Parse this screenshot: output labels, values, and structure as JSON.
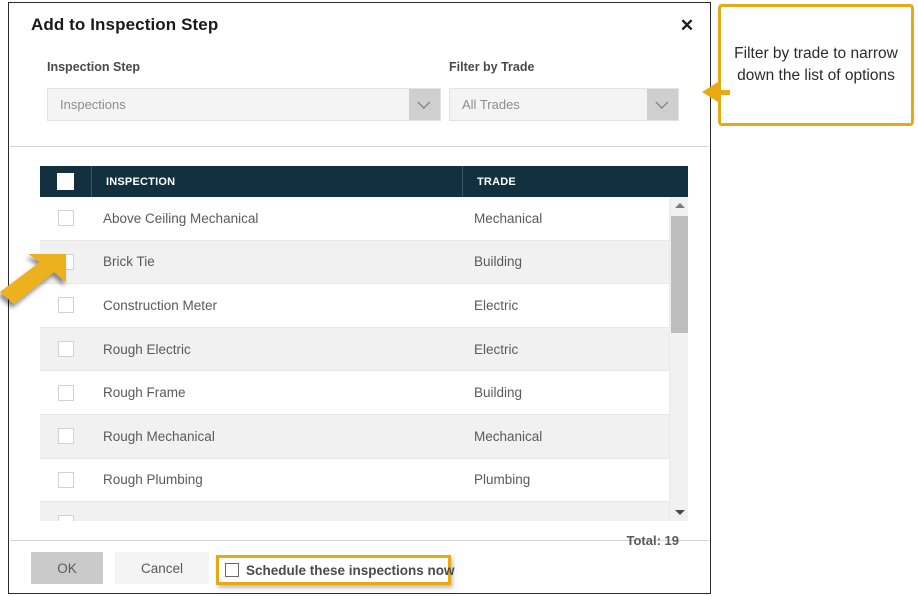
{
  "dialog": {
    "title": "Add to Inspection Step",
    "close_icon": "close-icon",
    "fields": {
      "inspection_step": {
        "label": "Inspection Step",
        "value": "Inspections",
        "chevron_icon": "chevron-down-icon"
      },
      "filter_by_trade": {
        "label": "Filter by Trade",
        "value": "All Trades",
        "chevron_icon": "chevron-down-icon"
      }
    },
    "table": {
      "columns": [
        "INSPECTION",
        "TRADE"
      ],
      "select_all_checked": true,
      "rows": [
        {
          "inspection": "Above Ceiling Mechanical",
          "trade": "Mechanical",
          "checked": false
        },
        {
          "inspection": "Brick Tie",
          "trade": "Building",
          "checked": false
        },
        {
          "inspection": "Construction Meter",
          "trade": "Electric",
          "checked": false
        },
        {
          "inspection": "Rough Electric",
          "trade": "Electric",
          "checked": false
        },
        {
          "inspection": "Rough Frame",
          "trade": "Building",
          "checked": false
        },
        {
          "inspection": "Rough Mechanical",
          "trade": "Mechanical",
          "checked": false
        },
        {
          "inspection": "Rough Plumbing",
          "trade": "Plumbing",
          "checked": false
        },
        {
          "inspection": "",
          "trade": "",
          "checked": false
        }
      ],
      "scrollbar": {
        "up_icon": "scroll-up-arrow-icon",
        "down_icon": "scroll-down-arrow-icon"
      }
    },
    "footer": {
      "total": "Total: 19",
      "ok_label": "OK",
      "cancel_label": "Cancel",
      "schedule_label": "Schedule these inspections now",
      "schedule_checked": false
    }
  },
  "annotations": {
    "callout_text": "Filter by trade to narrow down the list of options",
    "accent_color": "#e8a913",
    "arrow_to_trade_filter": "arrow-icon",
    "arrow_to_row_checkbox": "arrow-icon"
  }
}
